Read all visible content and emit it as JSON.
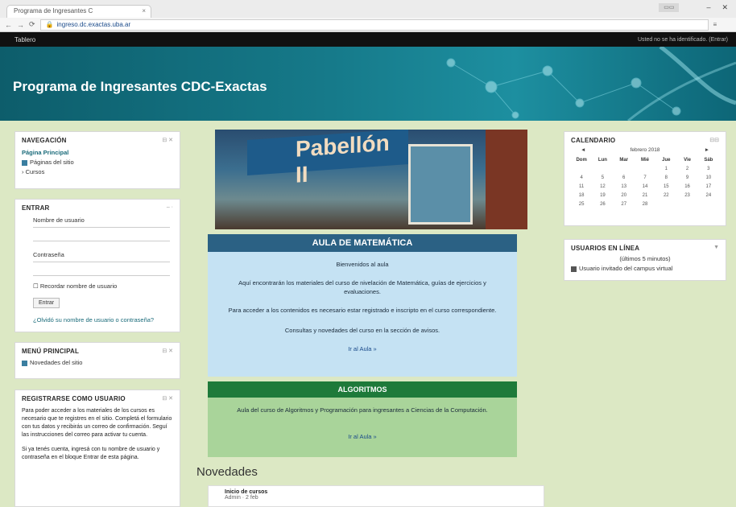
{
  "browser": {
    "tab_title": "Programa de Ingresantes C",
    "tab_close": "×",
    "address": "ingreso.dc.exactas.uba.ar",
    "nav_back": "←",
    "nav_forward": "→",
    "nav_reload": "⟳",
    "menu": "≡"
  },
  "site": {
    "navbar_title": "Tablero",
    "login_link": "Usted no se ha identificado. (Entrar)",
    "banner_title": "Programa de Ingresantes CDC-Exactas"
  },
  "left": {
    "nav_block": {
      "title": "NAVEGACIÓN",
      "items": [
        "Página Principal",
        "Páginas del sitio",
        "Cursos"
      ]
    },
    "login_block": {
      "title": "ENTRAR",
      "username_label": "Nombre de usuario",
      "password_label": "Contraseña",
      "remember_label": "Recordar nombre de usuario",
      "button_label": "Entrar",
      "forgot_link": "¿Olvidó su nombre de usuario o contraseña?"
    },
    "menu_block": {
      "title": "MENÚ PRINCIPAL",
      "item": "Novedades del sitio"
    },
    "about_block": {
      "title": "REGISTRARSE COMO USUARIO",
      "para1": "Para poder acceder a los materiales de los cursos es necesario que te registres en el sitio. Completá el formulario con tus datos y recibirás un correo de confirmación. Seguí las instrucciones del correo para activar tu cuenta.",
      "para2": "Si ya tenés cuenta, ingresá con tu nombre de usuario y contraseña en el bloque Entrar de esta página."
    }
  },
  "center": {
    "hero_sign_text": "Pabellón II",
    "math": {
      "title": "AULA DE MATEMÁTICA",
      "line1": "Bienvenidos al aula",
      "line2": "Aquí encontrarán los materiales del curso de nivelación de Matemática, guías de ejercicios y evaluaciones.",
      "line3": "Para acceder a los contenidos es necesario estar registrado e inscripto en el curso correspondiente.",
      "line4": "Consultas y novedades del curso en la sección de avisos.",
      "link": "Ir al Aula »"
    },
    "alg": {
      "title": "ALGORITMOS",
      "line1": "Aula del curso de Algoritmos y Programación para ingresantes a Ciencias de la Computación.",
      "link": "Ir al Aula »"
    },
    "news_title": "Novedades",
    "news_item_title": "Inicio de cursos",
    "news_item_sub": "Admin · 2 feb"
  },
  "right": {
    "calendar": {
      "title": "CALENDARIO",
      "prev": "◄",
      "month": "febrero 2018",
      "next": "►",
      "days": [
        "Dom",
        "Lun",
        "Mar",
        "Mié",
        "Jue",
        "Vie",
        "Sáb"
      ],
      "weeks": [
        [
          "",
          "",
          "",
          "",
          "1",
          "2",
          "3"
        ],
        [
          "4",
          "5",
          "6",
          "7",
          "8",
          "9",
          "10"
        ],
        [
          "11",
          "12",
          "13",
          "14",
          "15",
          "16",
          "17"
        ],
        [
          "18",
          "19",
          "20",
          "21",
          "22",
          "23",
          "24"
        ],
        [
          "25",
          "26",
          "27",
          "28",
          "",
          "",
          ""
        ]
      ]
    },
    "online": {
      "title": "USUARIOS EN LÍNEA",
      "subtitle": "(últimos 5 minutos)",
      "item": "Usuario invitado del campus virtual"
    }
  },
  "colors": {
    "page_bg": "#dce8c4",
    "math_head": "#2b6184",
    "math_body": "#c5e2f3",
    "alg_head": "#1e7a3a",
    "alg_body": "#a9d49a"
  }
}
